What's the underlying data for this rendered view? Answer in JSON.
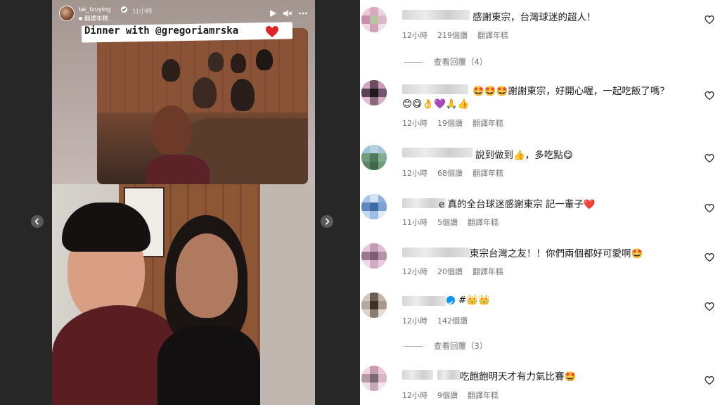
{
  "story": {
    "username": "tai_tzuying",
    "time_ago": "11小時",
    "translate_label": "翻譯年糕",
    "caption": "Dinner with @gregoriamrska",
    "icons": [
      "play-icon",
      "mute-icon",
      "more-icon",
      "verified-icon",
      "heart-icon"
    ]
  },
  "comments": [
    {
      "text": "感謝東宗，台灣球迷的超人！",
      "time": "12小時",
      "likes": "219個讚",
      "translate": "翻譯年糕",
      "view_replies": "查看回覆（4）"
    },
    {
      "text": "🤩🤩🤩謝謝東宗，好開心喔，一起吃飯了嗎？",
      "text2": "😊😋👌💜🙏👍",
      "time": "12小時",
      "likes": "19個讚",
      "translate": "翻譯年糕"
    },
    {
      "text": "說到做到👍，多吃點😋",
      "time": "12小時",
      "likes": "68個讚",
      "translate": "翻譯年糕"
    },
    {
      "text": "e 真的全台球迷感謝東宗 記一輩子❤️",
      "time": "11小時",
      "likes": "5個讚",
      "translate": "翻譯年糕"
    },
    {
      "text": "東宗台灣之友！！你們兩個都好可愛啊🤩",
      "time": "12小時",
      "likes": "20個讚",
      "translate": "翻譯年糕"
    },
    {
      "text": "#👑👑",
      "time": "12小時",
      "likes": "142個讚",
      "view_replies": "查看回覆（3）"
    },
    {
      "text": "吃飽飽明天才有力氣比賽🤩",
      "time": "12小時",
      "likes": "9個讚",
      "translate": "翻譯年糕"
    }
  ]
}
